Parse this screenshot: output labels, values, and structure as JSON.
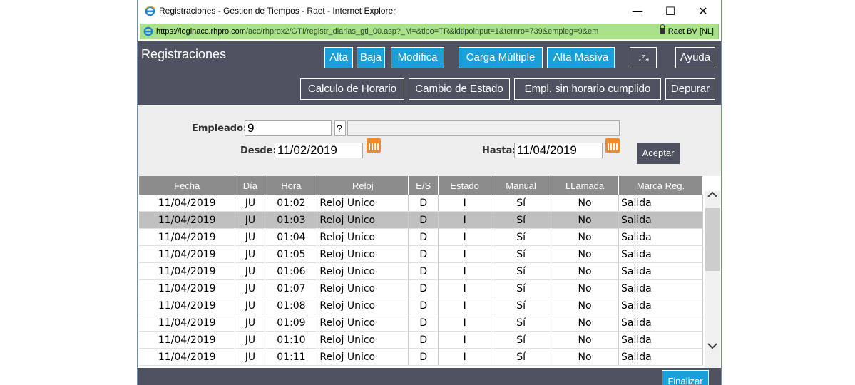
{
  "window": {
    "title": "Registraciones - Gestion de Tiempos - Raet - Internet Explorer",
    "url_prefix": "https://loginacc.",
    "url_host": "rhpro.com",
    "url_rest": "/acc/rhprox2/GTI/registr_diarias_gti_00.asp?_M=&tipo=TR&idtipoinput=1&ternro=739&empleg=9&em",
    "site_identity": "Raet BV [NL]",
    "minimize": "—",
    "maximize": "☐",
    "close": "✕"
  },
  "header": {
    "title": "Registraciones",
    "buttons": {
      "alta": "Alta",
      "baja": "Baja",
      "modifica": "Modifica",
      "carga_multiple": "Carga Múltiple",
      "alta_masiva": "Alta Masiva",
      "sort_icon": "↓ᶻₐ",
      "ayuda": "Ayuda",
      "calculo_horario": "Calculo de Horario",
      "cambio_estado": "Cambio de Estado",
      "empl_sin_horario": "Empl. sin horario cumplido",
      "depurar": "Depurar"
    }
  },
  "form": {
    "empleado_label": "Empleado:",
    "empleado_value": "9",
    "help_button": "?",
    "desde_label": "Desde:",
    "desde_value": "11/02/2019",
    "hasta_label": "Hasta:",
    "hasta_value": "11/04/2019",
    "aceptar": "Aceptar"
  },
  "table": {
    "columns": [
      "Fecha",
      "Día",
      "Hora",
      "Reloj",
      "E/S",
      "Estado",
      "Manual",
      "LLamada",
      "Marca Reg."
    ],
    "rows": [
      [
        "11/04/2019",
        "JU",
        "01:02",
        "Reloj Unico",
        "D",
        "I",
        "Sí",
        "No",
        "Salida"
      ],
      [
        "11/04/2019",
        "JU",
        "01:03",
        "Reloj Unico",
        "D",
        "I",
        "Sí",
        "No",
        "Salida"
      ],
      [
        "11/04/2019",
        "JU",
        "01:04",
        "Reloj Unico",
        "D",
        "I",
        "Sí",
        "No",
        "Salida"
      ],
      [
        "11/04/2019",
        "JU",
        "01:05",
        "Reloj Unico",
        "D",
        "I",
        "Sí",
        "No",
        "Salida"
      ],
      [
        "11/04/2019",
        "JU",
        "01:06",
        "Reloj Unico",
        "D",
        "I",
        "Sí",
        "No",
        "Salida"
      ],
      [
        "11/04/2019",
        "JU",
        "01:07",
        "Reloj Unico",
        "D",
        "I",
        "Sí",
        "No",
        "Salida"
      ],
      [
        "11/04/2019",
        "JU",
        "01:08",
        "Reloj Unico",
        "D",
        "I",
        "Sí",
        "No",
        "Salida"
      ],
      [
        "11/04/2019",
        "JU",
        "01:09",
        "Reloj Unico",
        "D",
        "I",
        "Sí",
        "No",
        "Salida"
      ],
      [
        "11/04/2019",
        "JU",
        "01:10",
        "Reloj Unico",
        "D",
        "I",
        "Sí",
        "No",
        "Salida"
      ],
      [
        "11/04/2019",
        "JU",
        "01:11",
        "Reloj Unico",
        "D",
        "I",
        "Sí",
        "No",
        "Salida"
      ]
    ]
  },
  "footer": {
    "finalizar": "Finalizar"
  },
  "colors": {
    "header_bg": "#4e5261",
    "accent": "#1aa0d8",
    "addr_bg": "#a9e28a"
  }
}
